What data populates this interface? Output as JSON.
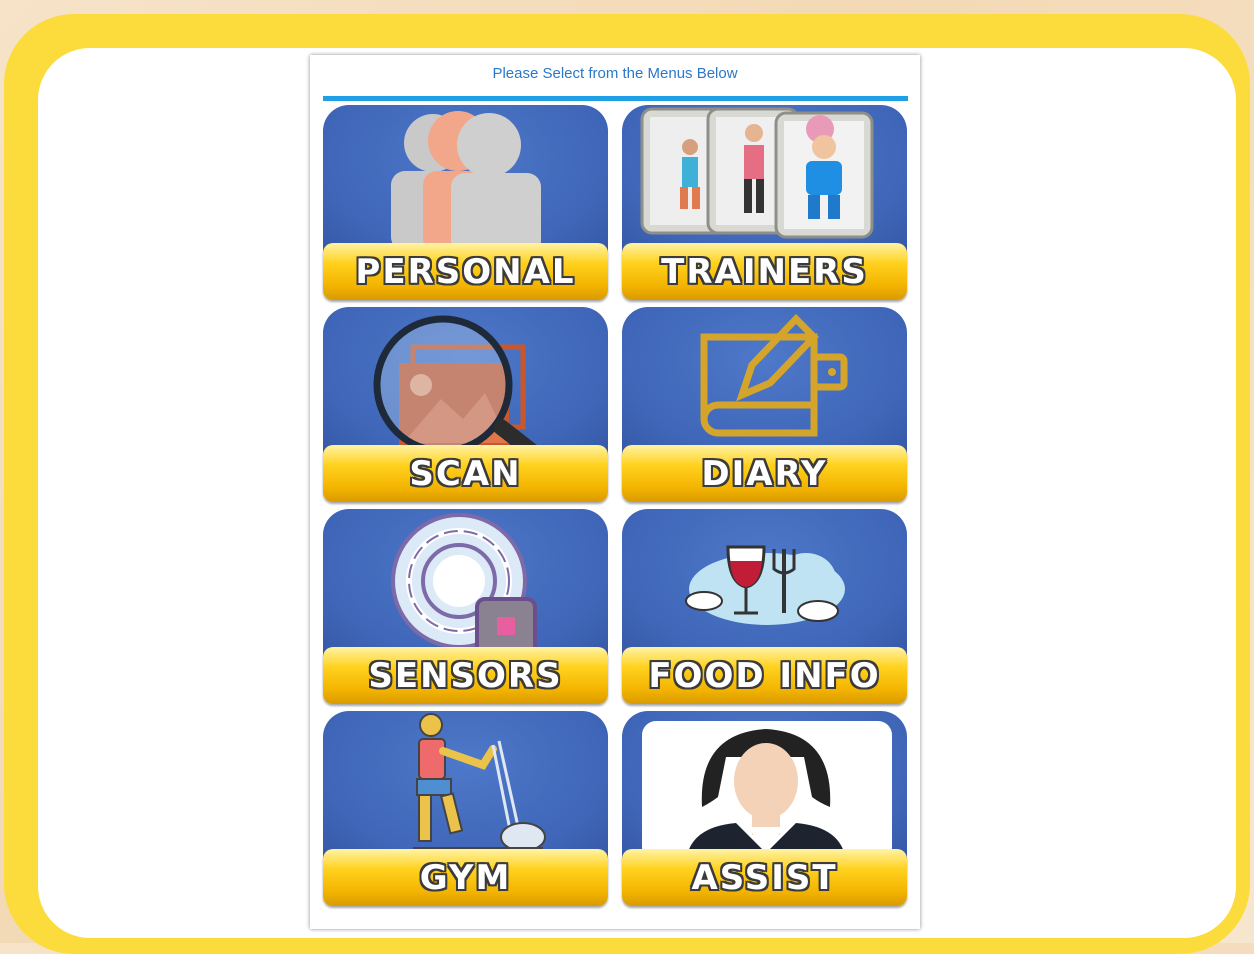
{
  "header": {
    "title": "Please Select from the Menus Below"
  },
  "menu": {
    "items": [
      {
        "label": "PERSONAL",
        "icon": "users-icon"
      },
      {
        "label": "TRAINERS",
        "icon": "trainers-icon"
      },
      {
        "label": "SCAN",
        "icon": "magnifier-image-icon"
      },
      {
        "label": "DIARY",
        "icon": "diary-icon"
      },
      {
        "label": "SENSORS",
        "icon": "sensor-icon"
      },
      {
        "label": "FOOD INFO",
        "icon": "food-icon"
      },
      {
        "label": "GYM",
        "icon": "gym-icon"
      },
      {
        "label": "ASSIST",
        "icon": "assistant-icon"
      }
    ]
  },
  "colors": {
    "frame": "#fbdc3c",
    "tile_blue": "#4a72c4",
    "label_gold": "#f3b400",
    "header_line": "#1fa0e6"
  }
}
